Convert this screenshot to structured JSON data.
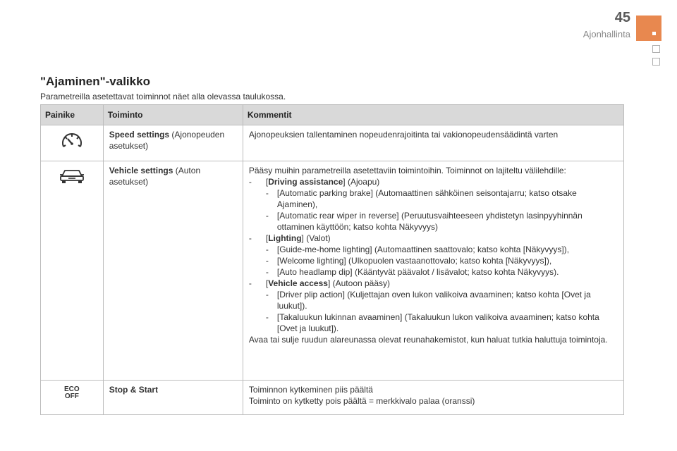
{
  "header": {
    "page_number": "45",
    "chapter": "Ajonhallinta",
    "accent_color": "#e8884f"
  },
  "title": "\"Ajaminen\"-valikko",
  "intro": "Parametreilla asetettavat toiminnot näet alla olevassa taulukossa.",
  "table": {
    "headers": [
      "Painike",
      "Toiminto",
      "Kommentit"
    ],
    "rows": [
      {
        "icon": "speedometer-icon",
        "function_bold": "Speed settings",
        "function_rest": " (Ajonopeuden asetukset)",
        "comment_lines": [
          "Ajonopeuksien tallentaminen nopeudenrajoitinta tai vakionopeudensäädintä varten"
        ]
      },
      {
        "icon": "car-icon",
        "function_bold": "Vehicle settings",
        "function_rest": " (Auton asetukset)",
        "comment_intro": "Pääsy muihin parametreilla asetettaviin toimintoihin. Toiminnot on lajiteltu välilehdille:",
        "groups": [
          {
            "bold": "Driving assistance",
            "rest": "] (Ajoapu)",
            "items": [
              "[Automatic parking brake] (Automaattinen sähköinen seisontajarru; katso otsake Ajaminen),",
              "[Automatic rear wiper in reverse] (Peruutusvaihteeseen yhdistetyn lasinpyyhinnän ottaminen käyttöön; katso kohta Näkyvyys)"
            ]
          },
          {
            "bold": "Lighting",
            "rest": "] (Valot)",
            "items": [
              "[Guide-me-home lighting] (Automaattinen saattovalo; katso kohta [Näkyvyys]),",
              "[Welcome lighting] (Ulkopuolen vastaanottovalo; katso kohta [Näkyvyys]),",
              "[Auto headlamp dip] (Kääntyvät päävalot / lisävalot; katso kohta Näkyvyys)."
            ]
          },
          {
            "bold": "Vehicle access",
            "rest": "] (Autoon pääsy)",
            "items": [
              "[Driver plip action] (Kuljettajan oven lukon valikoiva avaaminen; katso kohta [Ovet ja luukut]).",
              "[Takaluukun lukinnan avaaminen] (Takaluukun lukon valikoiva avaaminen; katso kohta [Ovet ja luukut])."
            ]
          }
        ],
        "comment_outro": "Avaa tai sulje ruudun alareunassa olevat reunahakemistot, kun haluat tutkia haluttuja toimintoja."
      },
      {
        "icon": "eco-off-icon",
        "icon_text_top": "ECO",
        "icon_text_bottom": "OFF",
        "function_bold": "Stop & Start",
        "function_rest": "",
        "comment_lines": [
          "Toiminnon kytkeminen piis päältä",
          "Toiminto on kytketty pois päältä = merkkivalo palaa (oranssi)"
        ]
      }
    ]
  }
}
